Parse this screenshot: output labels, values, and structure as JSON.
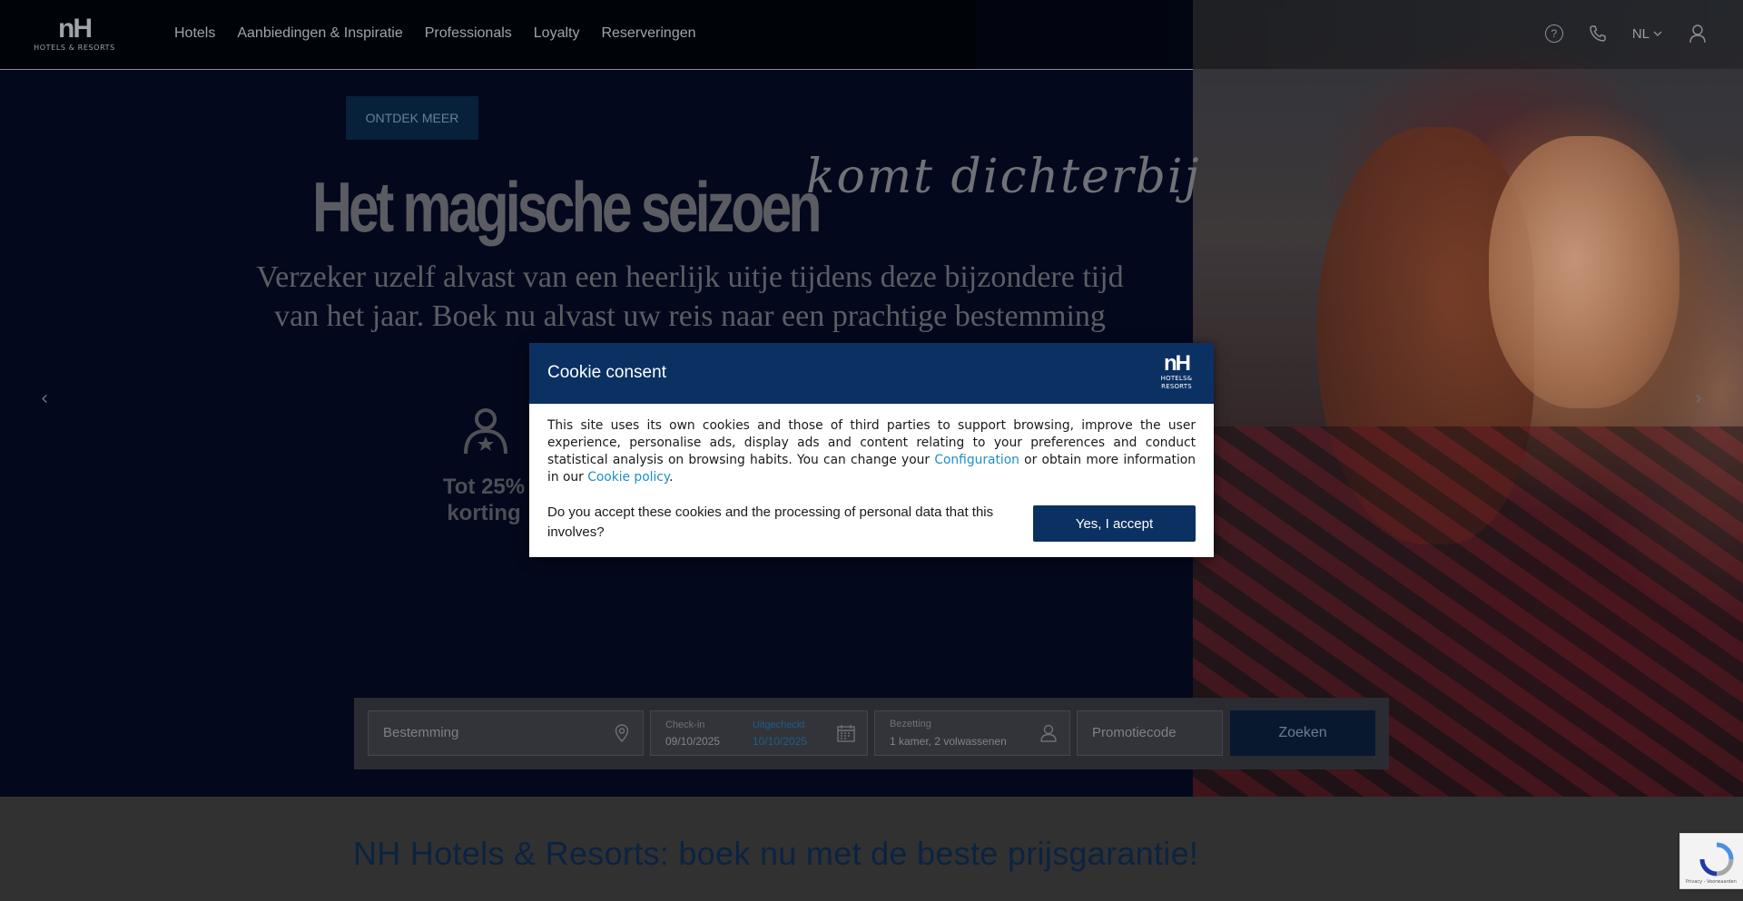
{
  "header": {
    "logo": {
      "mark": "nH",
      "sub": "HOTELS & RESORTS"
    },
    "nav": [
      "Hotels",
      "Aanbiedingen & Inspiratie",
      "Professionals",
      "Loyalty",
      "Reserveringen"
    ],
    "language": "NL",
    "icons": [
      "help-icon",
      "phone-icon",
      "chevron-down-icon",
      "user-icon"
    ]
  },
  "hero": {
    "cta": "ONTDEK MEER",
    "headline": "Het magische seizoen",
    "headline_script": "komt dichterbij",
    "subtitle": "Verzeker uzelf alvast van een heerlijk uitje tijdens deze bijzondere tijd van het jaar. Boek nu alvast uw reis naar een prachtige bestemming",
    "benefit": "Tot 25% korting",
    "prev_icon": "chevron-left-icon",
    "next_icon": "chevron-right-icon"
  },
  "search": {
    "destination_placeholder": "Bestemming",
    "checkin_label": "Check-in",
    "checkin_value": "09/10/2025",
    "checkout_label": "Uitgecheckt",
    "checkout_value": "10/10/2025",
    "occupancy_label": "Bezetting",
    "occupancy_value": "1 kamer, 2 volwassenen",
    "promo_placeholder": "Promotiecode",
    "submit": "Zoeken"
  },
  "page": {
    "title": "NH Hotels & Resorts: boek nu met de beste prijsgarantie!"
  },
  "cookie": {
    "title": "Cookie consent",
    "logo_mark": "nH",
    "logo_sub_1": "HOTELS&",
    "logo_sub_2": "RESORTS",
    "body_1": "This site uses its own cookies and those of third parties to support browsing, improve the user experience, personalise ads, display ads and content relating to your preferences and conduct statistical analysis on browsing habits. You can change your ",
    "link_config": "Configuration",
    "body_2": " or obtain more information in our ",
    "link_policy": "Cookie policy",
    "body_3": ".",
    "question": "Do you accept these cookies and the processing of personal data that this involves?",
    "accept": "Yes, I accept"
  },
  "recaptcha": {
    "label": "Privacy - Voorwaarden"
  },
  "colors": {
    "brand_navy": "#0b3163",
    "link": "#1e8fc6",
    "overlay": "#03081d"
  }
}
